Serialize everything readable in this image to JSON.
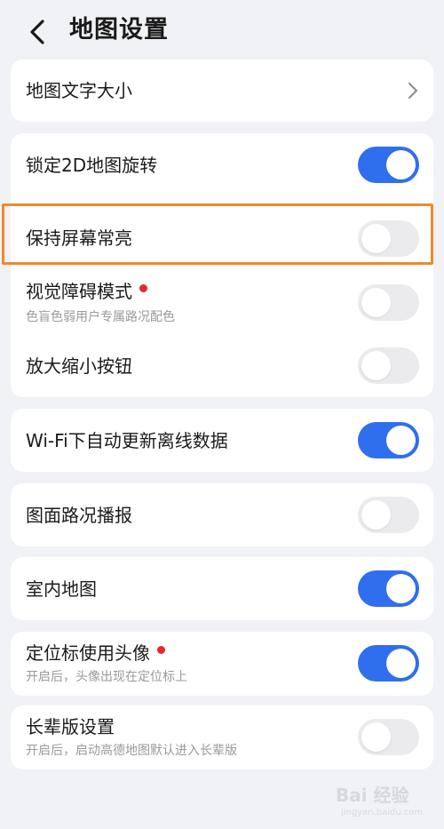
{
  "header": {
    "title": "地图设置"
  },
  "rows": {
    "text_size": {
      "label": "地图文字大小"
    },
    "lock_rotation": {
      "label": "锁定2D地图旋转",
      "enabled": true
    },
    "keep_screen_on": {
      "label": "保持屏幕常亮",
      "enabled": false
    },
    "vision_mode": {
      "label": "视觉障碍模式",
      "subtitle": "色盲色弱用户专属路况配色",
      "enabled": false,
      "has_red_dot": true
    },
    "zoom_buttons": {
      "label": "放大缩小按钮",
      "enabled": false
    },
    "wifi_update": {
      "label": "Wi-Fi下自动更新离线数据",
      "enabled": true
    },
    "traffic_broadcast": {
      "label": "图面路况播报",
      "enabled": false
    },
    "indoor_map": {
      "label": "室内地图",
      "enabled": true
    },
    "avatar_marker": {
      "label": "定位标使用头像",
      "subtitle": "开启后，头像出现在定位标上",
      "enabled": true,
      "has_red_dot": true
    },
    "elder_mode": {
      "label": "长辈版设置",
      "subtitle": "开启后，启动高德地图默认进入长辈版",
      "enabled": false
    }
  },
  "colors": {
    "toggle_on": "#2f6fee",
    "toggle_off": "#ebebed",
    "highlight_border": "#f0892a",
    "red_dot": "#e8262c"
  },
  "watermark": {
    "text": "Bai 经验",
    "url": "jingyan.baidu.com"
  }
}
